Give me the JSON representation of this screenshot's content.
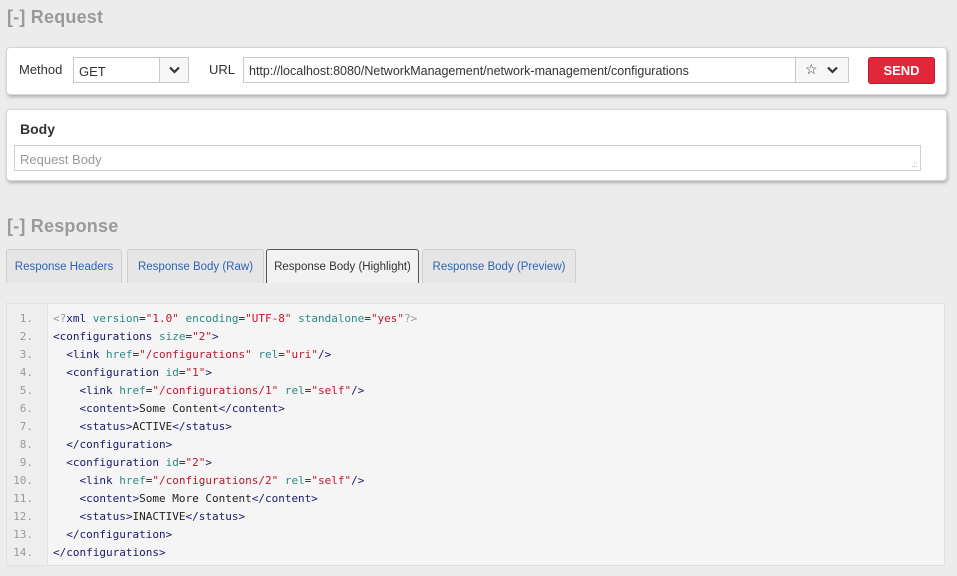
{
  "request": {
    "toggle": "[-]",
    "title": "Request",
    "method_label": "Method",
    "method_value": "GET",
    "url_label": "URL",
    "url_value": "http://localhost:8080/NetworkManagement/network-management/configurations",
    "send_label": "SEND",
    "send_color": "#e4263a",
    "icons": {
      "method_dropdown": "chevron-down-icon",
      "favorite": "star-icon",
      "url_dropdown": "chevron-down-icon"
    }
  },
  "body": {
    "label": "Body",
    "placeholder": "Request Body"
  },
  "response": {
    "toggle": "[-]",
    "title": "Response",
    "tabs": [
      {
        "label": "Response Headers",
        "active": false
      },
      {
        "label": "Response Body (Raw)",
        "active": false
      },
      {
        "label": "Response Body (Highlight)",
        "active": true
      },
      {
        "label": "Response Body (Preview)",
        "active": false
      }
    ],
    "code_lines": [
      {
        "num": "1.",
        "tokens": [
          [
            "pi",
            "<?"
          ],
          [
            "tag",
            "xml "
          ],
          [
            "attr",
            "version"
          ],
          [
            "text",
            "="
          ],
          [
            "val",
            "\"1.0\""
          ],
          [
            "text",
            " "
          ],
          [
            "attr",
            "encoding"
          ],
          [
            "text",
            "="
          ],
          [
            "val",
            "\"UTF-8\""
          ],
          [
            "text",
            " "
          ],
          [
            "attr",
            "standalone"
          ],
          [
            "text",
            "="
          ],
          [
            "val",
            "\"yes\""
          ],
          [
            "pi",
            "?>"
          ]
        ]
      },
      {
        "num": "2.",
        "tokens": [
          [
            "tag",
            "<configurations "
          ],
          [
            "attr",
            "size"
          ],
          [
            "text",
            "="
          ],
          [
            "val",
            "\"2\""
          ],
          [
            "tag",
            ">"
          ]
        ]
      },
      {
        "num": "3.",
        "tokens": [
          [
            "text",
            "  "
          ],
          [
            "tag",
            "<link "
          ],
          [
            "attr",
            "href"
          ],
          [
            "text",
            "="
          ],
          [
            "val",
            "\"/configurations\""
          ],
          [
            "text",
            " "
          ],
          [
            "attr",
            "rel"
          ],
          [
            "text",
            "="
          ],
          [
            "val",
            "\"uri\""
          ],
          [
            "tag",
            "/>"
          ]
        ]
      },
      {
        "num": "4.",
        "tokens": [
          [
            "text",
            "  "
          ],
          [
            "tag",
            "<configuration "
          ],
          [
            "attr",
            "id"
          ],
          [
            "text",
            "="
          ],
          [
            "val",
            "\"1\""
          ],
          [
            "tag",
            ">"
          ]
        ]
      },
      {
        "num": "5.",
        "tokens": [
          [
            "text",
            "    "
          ],
          [
            "tag",
            "<link "
          ],
          [
            "attr",
            "href"
          ],
          [
            "text",
            "="
          ],
          [
            "val",
            "\"/configurations/1\""
          ],
          [
            "text",
            " "
          ],
          [
            "attr",
            "rel"
          ],
          [
            "text",
            "="
          ],
          [
            "val",
            "\"self\""
          ],
          [
            "tag",
            "/>"
          ]
        ]
      },
      {
        "num": "6.",
        "tokens": [
          [
            "text",
            "    "
          ],
          [
            "tag",
            "<content>"
          ],
          [
            "text",
            "Some Content"
          ],
          [
            "tag",
            "</content>"
          ]
        ]
      },
      {
        "num": "7.",
        "tokens": [
          [
            "text",
            "    "
          ],
          [
            "tag",
            "<status>"
          ],
          [
            "text",
            "ACTIVE"
          ],
          [
            "tag",
            "</status>"
          ]
        ]
      },
      {
        "num": "8.",
        "tokens": [
          [
            "text",
            "  "
          ],
          [
            "tag",
            "</configuration>"
          ]
        ]
      },
      {
        "num": "9.",
        "tokens": [
          [
            "text",
            "  "
          ],
          [
            "tag",
            "<configuration "
          ],
          [
            "attr",
            "id"
          ],
          [
            "text",
            "="
          ],
          [
            "val",
            "\"2\""
          ],
          [
            "tag",
            ">"
          ]
        ]
      },
      {
        "num": "10.",
        "tokens": [
          [
            "text",
            "    "
          ],
          [
            "tag",
            "<link "
          ],
          [
            "attr",
            "href"
          ],
          [
            "text",
            "="
          ],
          [
            "val",
            "\"/configurations/2\""
          ],
          [
            "text",
            " "
          ],
          [
            "attr",
            "rel"
          ],
          [
            "text",
            "="
          ],
          [
            "val",
            "\"self\""
          ],
          [
            "tag",
            "/>"
          ]
        ]
      },
      {
        "num": "11.",
        "tokens": [
          [
            "text",
            "    "
          ],
          [
            "tag",
            "<content>"
          ],
          [
            "text",
            "Some More Content"
          ],
          [
            "tag",
            "</content>"
          ]
        ]
      },
      {
        "num": "12.",
        "tokens": [
          [
            "text",
            "    "
          ],
          [
            "tag",
            "<status>"
          ],
          [
            "text",
            "INACTIVE"
          ],
          [
            "tag",
            "</status>"
          ]
        ]
      },
      {
        "num": "13.",
        "tokens": [
          [
            "text",
            "  "
          ],
          [
            "tag",
            "</configuration>"
          ]
        ]
      },
      {
        "num": "14.",
        "tokens": [
          [
            "tag",
            "</configurations>"
          ]
        ]
      }
    ]
  }
}
